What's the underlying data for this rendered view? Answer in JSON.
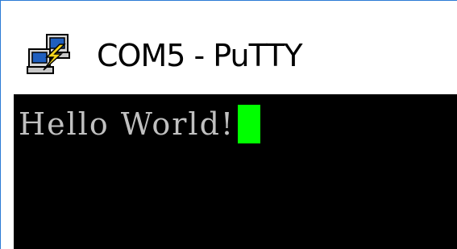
{
  "window": {
    "title": "COM5 - PuTTY",
    "icon": "putty-computers-icon"
  },
  "terminal": {
    "lines": [
      "Hello World!"
    ],
    "cursor_color": "#00ff00",
    "text_color": "#c0c0c0",
    "background_color": "#000000"
  }
}
